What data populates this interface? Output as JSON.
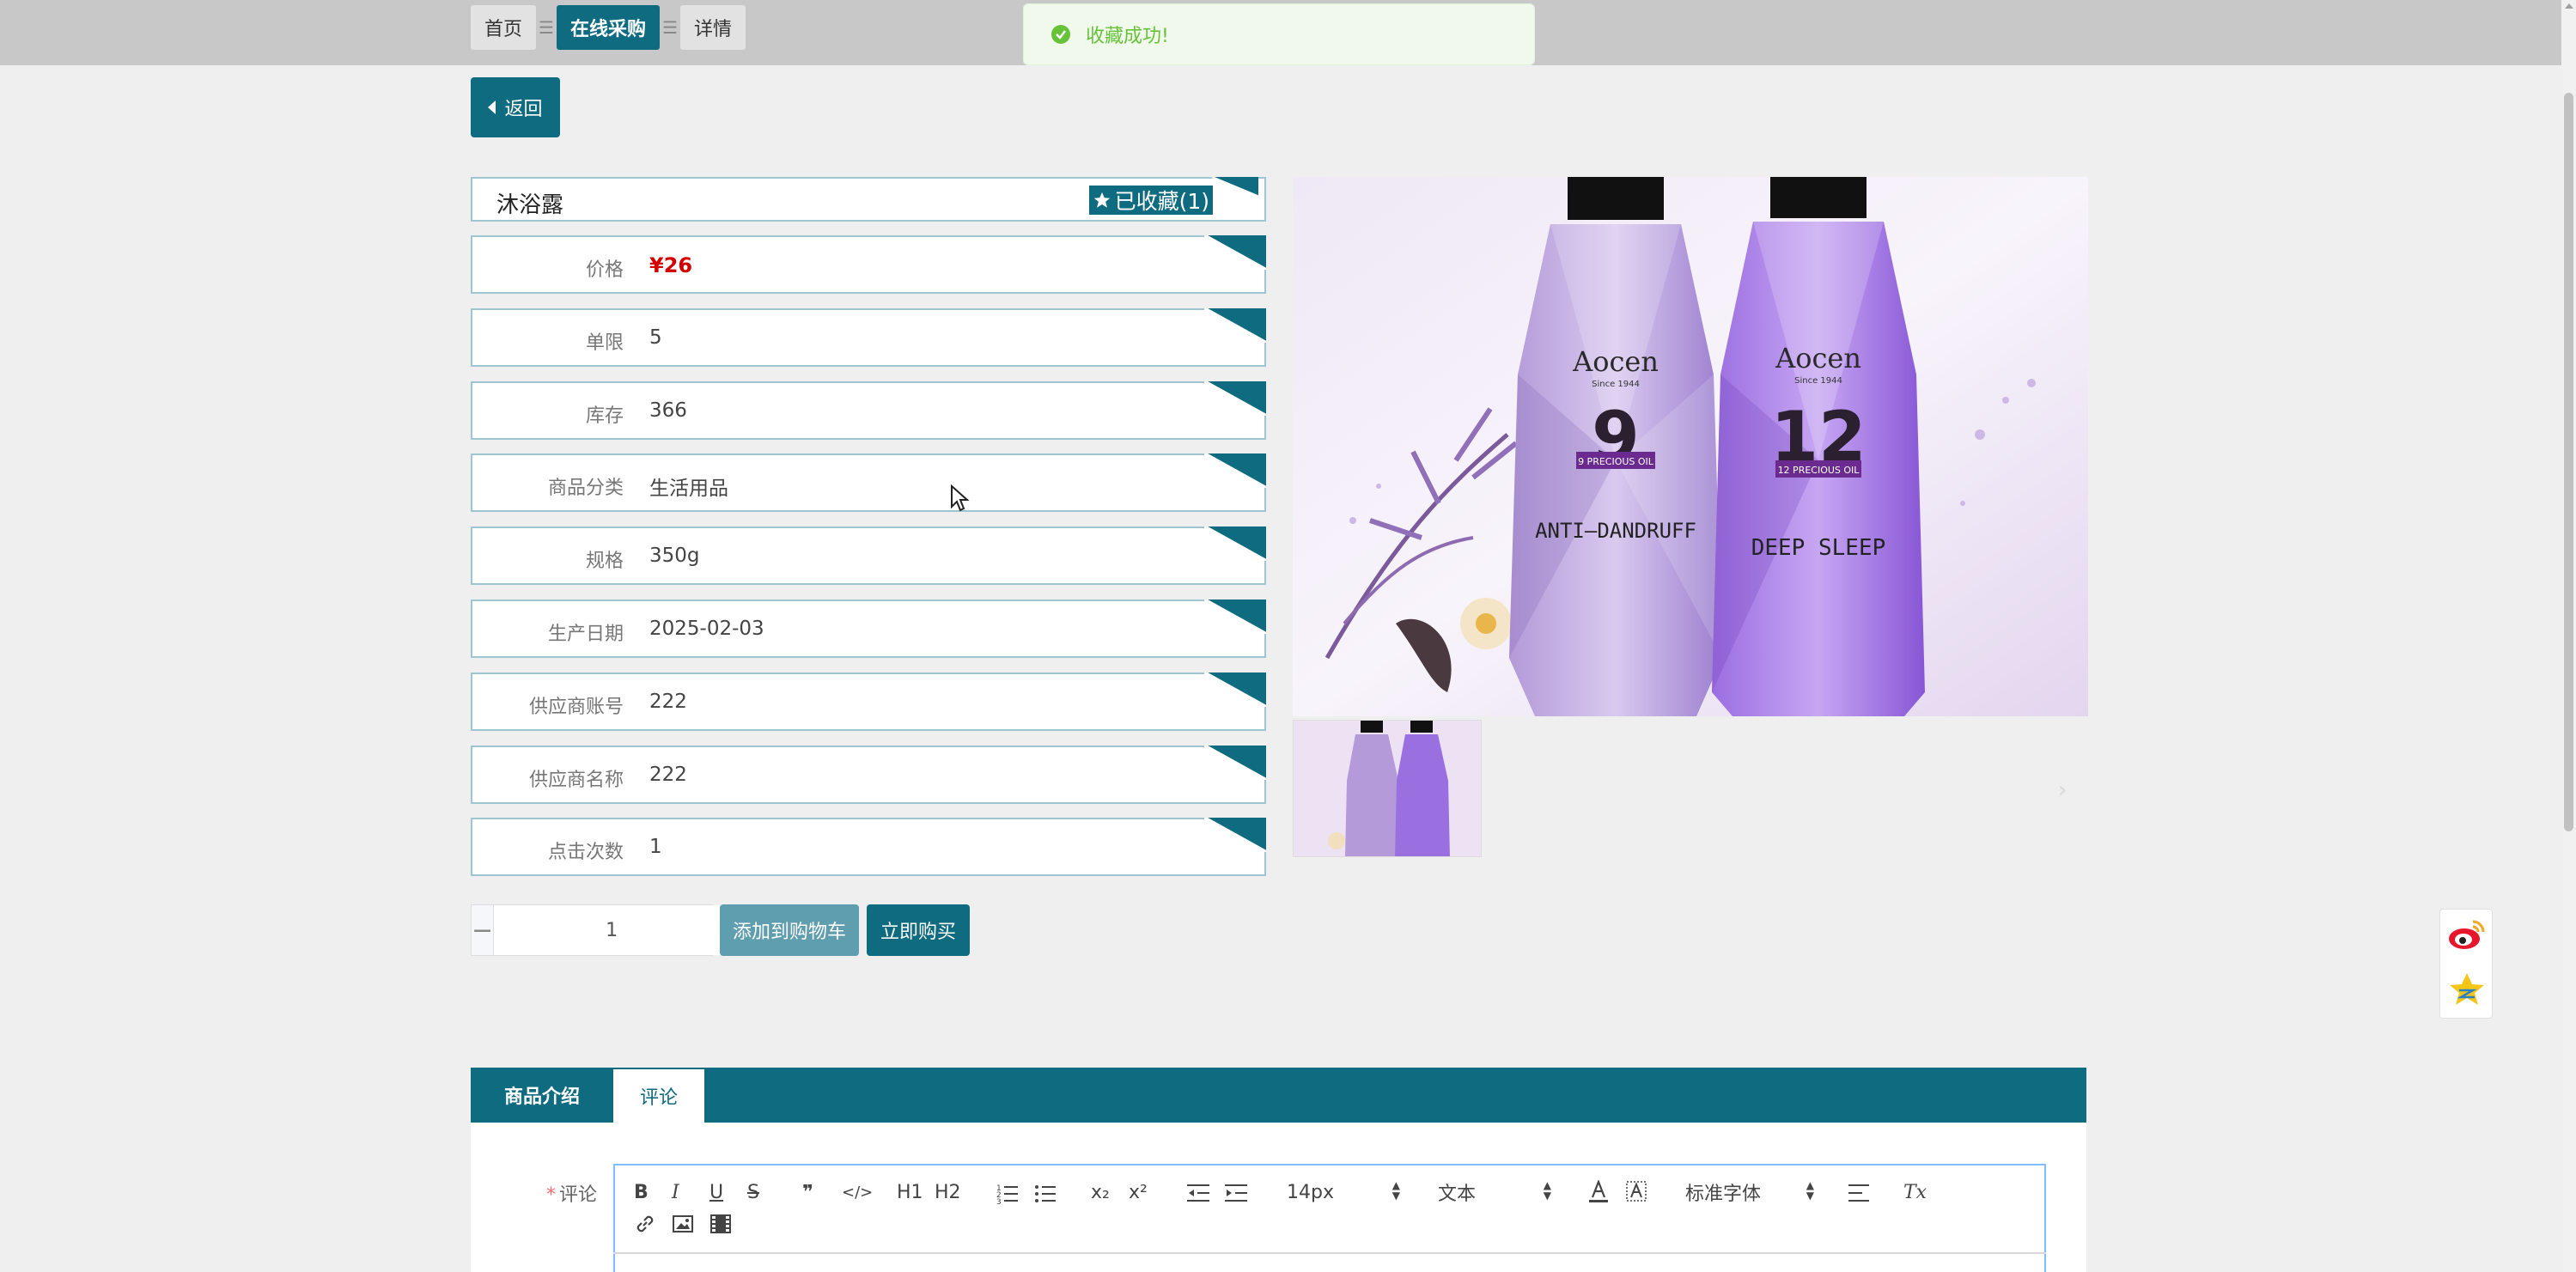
{
  "breadcrumb": {
    "items": [
      {
        "label": "首页",
        "active": false
      },
      {
        "label": "在线采购",
        "active": true
      },
      {
        "label": "详情",
        "active": false
      }
    ],
    "separator": "☰"
  },
  "toast": {
    "message": "收藏成功!"
  },
  "back_label": "返回",
  "product": {
    "title": "沐浴露",
    "favorite_label": "已收藏(1)",
    "fields": [
      {
        "label": "价格",
        "value": "¥26"
      },
      {
        "label": "单限",
        "value": "5"
      },
      {
        "label": "库存",
        "value": "366"
      },
      {
        "label": "商品分类",
        "value": "生活用品"
      },
      {
        "label": "规格",
        "value": "350g"
      },
      {
        "label": "生产日期",
        "value": "2025-02-03"
      },
      {
        "label": "供应商账号",
        "value": "222"
      },
      {
        "label": "供应商名称",
        "value": "222"
      },
      {
        "label": "点击次数",
        "value": "1"
      }
    ]
  },
  "purchase": {
    "quantity": "1",
    "minus": "−",
    "plus": "+",
    "add_to_cart": "添加到购物车",
    "buy_now": "立即购买"
  },
  "image": {
    "bottle_left": {
      "brand": "Aocen",
      "since": "Since 1944",
      "number": "9",
      "oil": "9 PRECIOUS OIL",
      "name": "ANTI—DANDRUFF"
    },
    "bottle_right": {
      "brand": "Aocen",
      "since": "Since 1944",
      "number": "12",
      "oil": "12 PRECIOUS OIL",
      "name": "DEEP SLEEP"
    },
    "next_arrow": "›"
  },
  "tabs": [
    {
      "label": "商品介绍",
      "active": false
    },
    {
      "label": "评论",
      "active": true
    }
  ],
  "comment_form": {
    "required_mark": "*",
    "label": "评论"
  },
  "editor_toolbar": {
    "bold": "B",
    "italic": "I",
    "underline": "U",
    "strike": "S",
    "quote": "❞",
    "code": "</>",
    "h1": "H1",
    "h2": "H2",
    "sub": "x₂",
    "sup": "x²",
    "size": "14px",
    "header": "文本",
    "font": "标准字体",
    "clean": "Tx"
  },
  "colors": {
    "primary": "#0f6b80",
    "cart_button": "#5f9eaf",
    "price": "#d40000",
    "toast_text": "#67c23a",
    "toast_bg": "#f0f9eb"
  }
}
